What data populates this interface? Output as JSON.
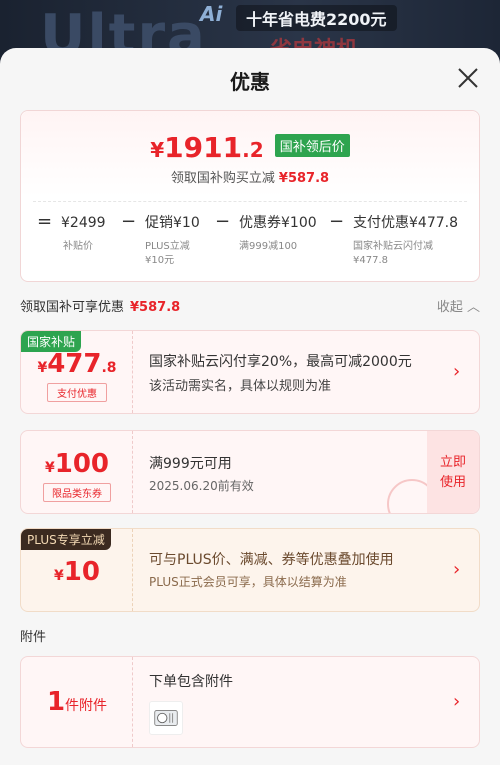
{
  "background": {
    "ai_label": "Ai",
    "slogan": "十年省电费2200元"
  },
  "sheet": {
    "title": "优惠"
  },
  "summary": {
    "price_symbol": "¥",
    "price_int": "1911",
    "price_dec": ".2",
    "price_tag": "国补领后价",
    "sub_text": "领取国补购买立减",
    "sub_amount": "¥587.8",
    "formula": [
      {
        "op": "=",
        "value": "¥2499",
        "label": "补贴价",
        "label2": ""
      },
      {
        "op": "−",
        "value": "促销¥10",
        "label": "PLUS立减",
        "label2": "¥10元"
      },
      {
        "op": "−",
        "value": "优惠券¥100",
        "label": "满999减100",
        "label2": ""
      },
      {
        "op": "−",
        "value": "支付优惠¥477.8",
        "label": "国家补贴云闪付减",
        "label2": "¥477.8"
      }
    ]
  },
  "claim": {
    "text": "领取国补可享优惠",
    "amount": "¥587.8",
    "collapse_label": "收起"
  },
  "coupons": [
    {
      "badge": "国家补贴",
      "badge_color": "#2ea44f",
      "symbol": "¥",
      "amount_int": "477",
      "amount_dec": ".8",
      "sublabel": "支付优惠",
      "line1": "国家补贴云闪付享20%，最高可减2000元",
      "line2": "该活动需实名，具体以规则为准"
    },
    {
      "symbol": "¥",
      "amount_int": "100",
      "sublabel": "限品类东券",
      "line1": "满999元可用",
      "line2": "2025.06.20前有效",
      "claim_btn_1": "立即",
      "claim_btn_2": "使用"
    },
    {
      "badge": "PLUS专享立减",
      "badge_color": "#3b2a20",
      "symbol": "¥",
      "amount_int": "10",
      "line1": "可与PLUS价、满减、券等优惠叠加使用",
      "line2": "PLUS正式会员可享，具体以结算为准"
    },
    {
      "amount_int": "1",
      "unit": "件附件",
      "line1": "下单包含附件"
    }
  ],
  "accessory_section_label": "附件",
  "colors": {
    "accent_red": "#e8242a",
    "gov_green": "#2ea44f",
    "plus_brown": "#3b2a20"
  }
}
